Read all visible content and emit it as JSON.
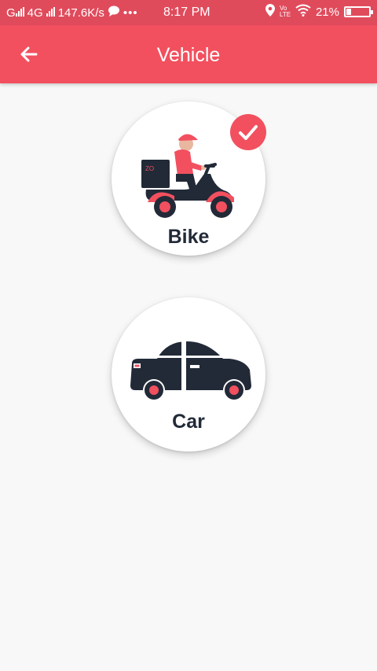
{
  "status_bar": {
    "network": "4G",
    "speed": "147.6K/s",
    "time": "8:17 PM",
    "volte": "Vo LTE",
    "battery": "21%",
    "battery_level": 0.21
  },
  "app_bar": {
    "title": "Vehicle",
    "back_icon": "arrow-left-icon"
  },
  "vehicles": [
    {
      "label": "Bike",
      "icon": "scooter-rider-icon",
      "selected": true
    },
    {
      "label": "Car",
      "icon": "car-icon",
      "selected": false
    }
  ],
  "colors": {
    "status_bar": "#e04b5c",
    "primary": "#f2505f",
    "dark": "#222a38",
    "background": "#f7f8f7"
  }
}
